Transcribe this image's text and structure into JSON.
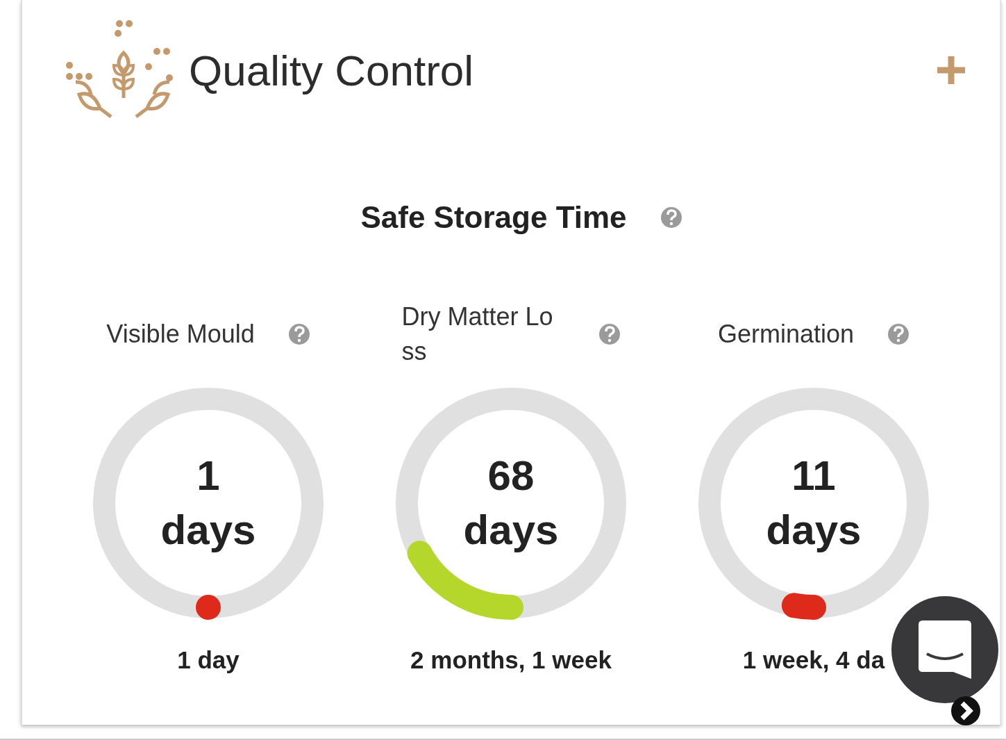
{
  "header": {
    "title": "Quality Control"
  },
  "section": {
    "title": "Safe Storage Time"
  },
  "gauges": [
    {
      "label": "Visible Mould",
      "value": "1",
      "unit": "days",
      "level": 0,
      "color": "#dd2a1b",
      "duration": "1 day"
    },
    {
      "label": "Dry Matter Loss",
      "value": "68",
      "unit": "days",
      "level": 0.17,
      "color": "#b5d62a",
      "duration": "2 months, 1 week"
    },
    {
      "label": "Germination",
      "value": "11",
      "unit": "days",
      "level": 0.03,
      "color": "#dd2a1b",
      "duration": "1 week, 4 da"
    }
  ]
}
